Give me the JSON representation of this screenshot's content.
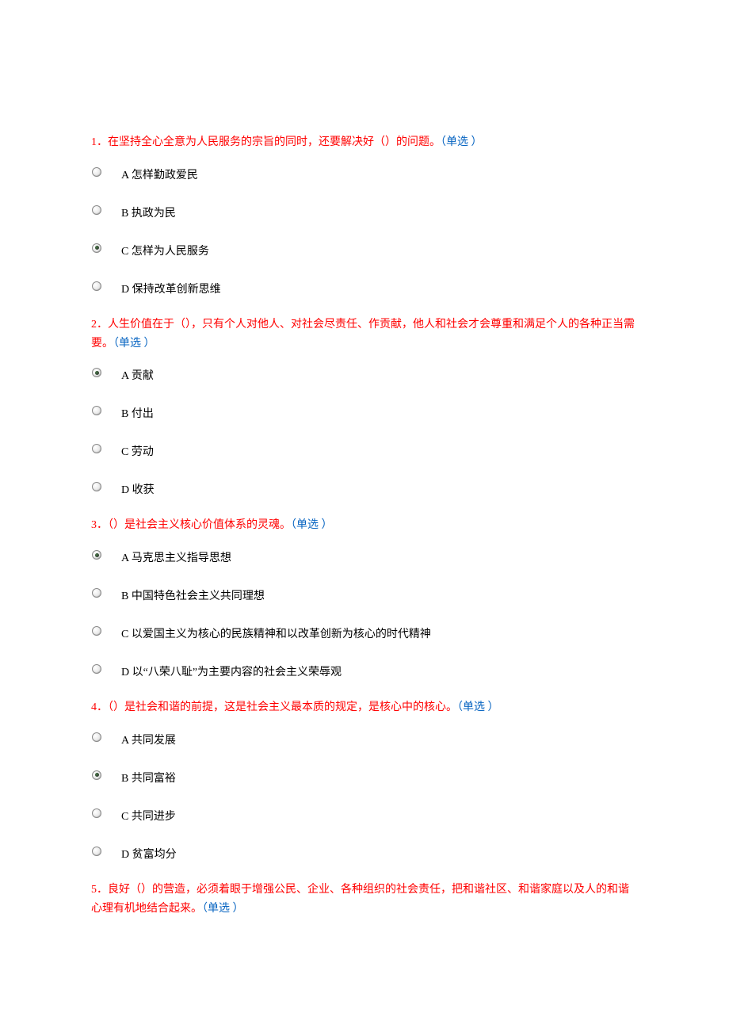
{
  "questions": [
    {
      "number": "1．",
      "text": "在坚持全心全意为人民服务的宗旨的同时，还要解决好（）的问题。",
      "type": "（单选 ）",
      "options": [
        {
          "label": "A 怎样勤政爱民",
          "selected": false
        },
        {
          "label": "B 执政为民",
          "selected": false
        },
        {
          "label": "C 怎样为人民服务",
          "selected": true
        },
        {
          "label": "D 保持改革创新思维",
          "selected": false
        }
      ]
    },
    {
      "number": "2．",
      "text": "人生价值在于（），只有个人对他人、对社会尽责任、作贡献，他人和社会才会尊重和满足个人的各种正当需要。",
      "type": "（单选 ）",
      "options": [
        {
          "label": "A 贡献",
          "selected": true
        },
        {
          "label": "B 付出",
          "selected": false
        },
        {
          "label": "C 劳动",
          "selected": false
        },
        {
          "label": "D 收获",
          "selected": false
        }
      ]
    },
    {
      "number": "3．",
      "text": "（）是社会主义核心价值体系的灵魂。",
      "type": "（单选 ）",
      "options": [
        {
          "label": "A 马克思主义指导思想",
          "selected": true
        },
        {
          "label": "B 中国特色社会主义共同理想",
          "selected": false
        },
        {
          "label": "C 以爱国主义为核心的民族精神和以改革创新为核心的时代精神",
          "selected": false
        },
        {
          "label": "D 以“八荣八耻”为主要内容的社会主义荣辱观",
          "selected": false
        }
      ]
    },
    {
      "number": "4．",
      "text": "（）是社会和谐的前提，这是社会主义最本质的规定，是核心中的核心。",
      "type": "（单选 ）",
      "options": [
        {
          "label": "A 共同发展",
          "selected": false
        },
        {
          "label": "B 共同富裕",
          "selected": true
        },
        {
          "label": "C 共同进步",
          "selected": false
        },
        {
          "label": "D 贫富均分",
          "selected": false
        }
      ]
    },
    {
      "number": "5．",
      "text": "良好（）的营造，必须着眼于增强公民、企业、各种组织的社会责任，把和谐社区、和谐家庭以及人的和谐心理有机地结合起来。",
      "type": "（单选 ）",
      "options": []
    }
  ]
}
